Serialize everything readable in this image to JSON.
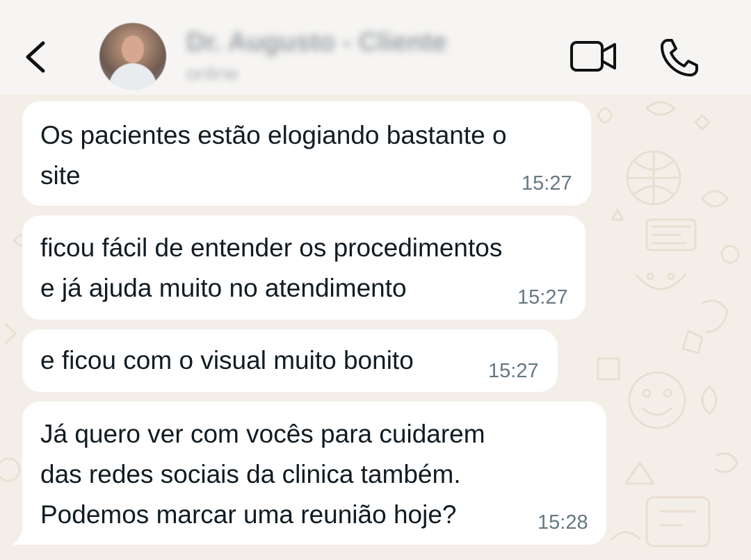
{
  "header": {
    "contact_name": "Dr. Augusto - Cliente",
    "contact_status": "online",
    "icons": {
      "back": "chevron-left-icon",
      "video": "video-camera-icon",
      "call": "phone-icon"
    }
  },
  "messages": [
    {
      "text": "Os pacientes estão elogiando bastante o\nsite",
      "time": "15:27",
      "direction": "incoming"
    },
    {
      "text": "ficou fácil de entender os procedimentos\ne já ajuda muito no atendimento",
      "time": "15:27",
      "direction": "incoming"
    },
    {
      "text": "e ficou com o visual muito bonito",
      "time": "15:27",
      "direction": "incoming"
    },
    {
      "text": "Já quero ver com vocês para cuidarem\ndas redes sociais da clinica também.\nPodemos marcar uma reunião hoje?",
      "time": "15:28",
      "direction": "incoming"
    }
  ],
  "colors": {
    "header_bg": "#f6f5f3",
    "chat_bg": "#f3efe8",
    "bubble_bg": "#ffffff",
    "text": "#111b21",
    "timestamp": "#667781"
  }
}
